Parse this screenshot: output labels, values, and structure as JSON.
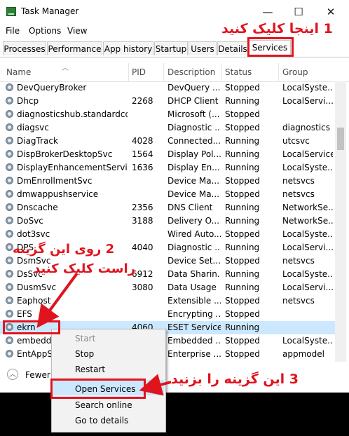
{
  "window": {
    "title": "Task Manager",
    "controls": {
      "minimize": "—",
      "maximize": "☐",
      "close": "✕"
    }
  },
  "menu": [
    "File",
    "Options",
    "View"
  ],
  "tabs": [
    "Processes",
    "Performance",
    "App history",
    "Startup",
    "Users",
    "Details",
    "Services"
  ],
  "active_tab": "Services",
  "columns": [
    "Name",
    "PID",
    "Description",
    "Status",
    "Group"
  ],
  "services": [
    {
      "name": "DevQueryBroker",
      "pid": "",
      "description": "DevQuery ...",
      "status": "Stopped",
      "group": "LocalSyste..."
    },
    {
      "name": "Dhcp",
      "pid": "2268",
      "description": "DHCP Client",
      "status": "Running",
      "group": "LocalServi..."
    },
    {
      "name": "diagnosticshub.standardco...",
      "pid": "",
      "description": "Microsoft (...",
      "status": "Stopped",
      "group": ""
    },
    {
      "name": "diagsvc",
      "pid": "",
      "description": "Diagnostic ...",
      "status": "Stopped",
      "group": "diagnostics"
    },
    {
      "name": "DiagTrack",
      "pid": "4028",
      "description": "Connected...",
      "status": "Running",
      "group": "utcsvc"
    },
    {
      "name": "DispBrokerDesktopSvc",
      "pid": "1564",
      "description": "Display Pol...",
      "status": "Running",
      "group": "LocalService"
    },
    {
      "name": "DisplayEnhancementService",
      "pid": "1636",
      "description": "Display En...",
      "status": "Running",
      "group": "LocalSyste..."
    },
    {
      "name": "DmEnrollmentSvc",
      "pid": "",
      "description": "Device Ma...",
      "status": "Stopped",
      "group": "netsvcs"
    },
    {
      "name": "dmwappushservice",
      "pid": "",
      "description": "Device Ma...",
      "status": "Stopped",
      "group": "netsvcs"
    },
    {
      "name": "Dnscache",
      "pid": "2356",
      "description": "DNS Client",
      "status": "Running",
      "group": "NetworkSe..."
    },
    {
      "name": "DoSvc",
      "pid": "3188",
      "description": "Delivery O...",
      "status": "Running",
      "group": "NetworkSe..."
    },
    {
      "name": "dot3svc",
      "pid": "",
      "description": "Wired Auto...",
      "status": "Stopped",
      "group": "LocalSyste..."
    },
    {
      "name": "DPS",
      "pid": "4040",
      "description": "Diagnostic ...",
      "status": "Running",
      "group": "LocalServi..."
    },
    {
      "name": "DsmSvc",
      "pid": "",
      "description": "Device Set...",
      "status": "Stopped",
      "group": "netsvcs"
    },
    {
      "name": "DsSvc",
      "pid": "6912",
      "description": "Data Sharin...",
      "status": "Running",
      "group": "LocalSyste..."
    },
    {
      "name": "DusmSvc",
      "pid": "3080",
      "description": "Data Usage",
      "status": "Running",
      "group": "LocalServi..."
    },
    {
      "name": "Eaphost",
      "pid": "",
      "description": "Extensible ...",
      "status": "Stopped",
      "group": "netsvcs"
    },
    {
      "name": "EFS",
      "pid": "",
      "description": "Encrypting ...",
      "status": "Stopped",
      "group": ""
    },
    {
      "name": "ekrn",
      "pid": "4060",
      "description": "ESET Service",
      "status": "Running",
      "group": ""
    },
    {
      "name": "embedde",
      "pid": "",
      "description": "Embedded ...",
      "status": "Stopped",
      "group": "LocalSyste..."
    },
    {
      "name": "EntAppSv",
      "pid": "",
      "description": "Enterprise ...",
      "status": "Stopped",
      "group": "appmodel"
    }
  ],
  "selected_index": 18,
  "footer": {
    "fewer_details": "Fewer"
  },
  "context_menu": [
    {
      "label": "Start",
      "disabled": true
    },
    {
      "label": "Stop",
      "disabled": false
    },
    {
      "label": "Restart",
      "disabled": false
    },
    {
      "label": "Open Services",
      "disabled": false
    },
    {
      "label": "Search online",
      "disabled": false
    },
    {
      "label": "Go to details",
      "disabled": false
    }
  ],
  "annotations": {
    "step1": "1 اینجا کلیک کنید",
    "step2_line1": "2 روی این گزینه",
    "step2_line2": "راست کلیک کنید",
    "step3": "3 این گزینه را بزنید"
  },
  "colors": {
    "annotation_red": "#e0141e",
    "selection_blue": "#cce8ff"
  }
}
